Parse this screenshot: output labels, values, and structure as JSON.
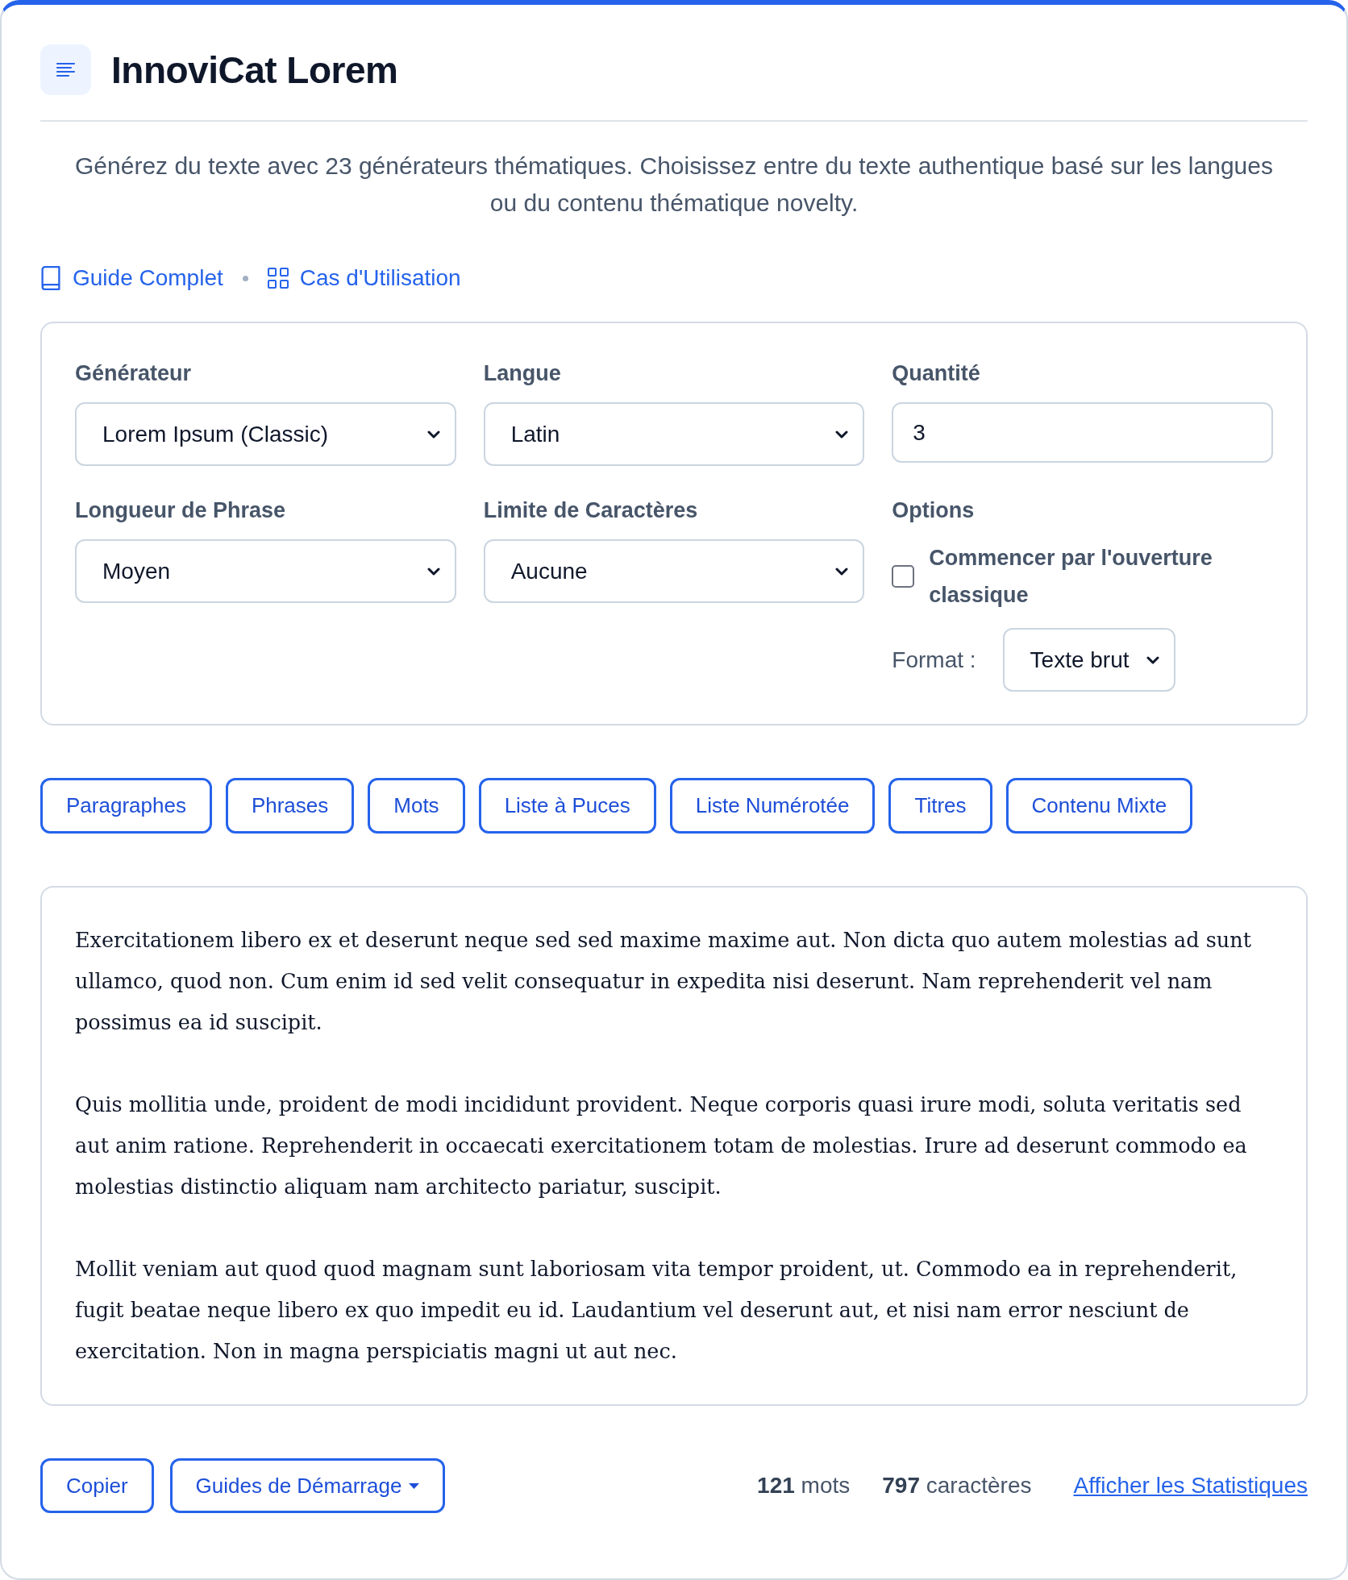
{
  "header": {
    "title": "InnoviCat Lorem"
  },
  "description": "Générez du texte avec 23 générateurs thématiques. Choisissez entre du texte authentique basé sur les langues ou du contenu thématique novelty.",
  "links": [
    {
      "kind": "book",
      "label": "Guide Complet"
    },
    {
      "kind": "grid",
      "label": "Cas d'Utilisation"
    }
  ],
  "settings": {
    "fields": [
      {
        "kind": "select",
        "label": "Générateur",
        "value": "Lorem Ipsum (Classic)"
      },
      {
        "kind": "select",
        "label": "Langue",
        "value": "Latin"
      },
      {
        "kind": "input",
        "label": "Quantité",
        "value": "3"
      },
      {
        "kind": "select",
        "label": "Longueur de Phrase",
        "value": "Moyen"
      },
      {
        "kind": "select",
        "label": "Limite de Caractères",
        "value": "Aucune"
      },
      {
        "kind": "options",
        "label": "Options",
        "checkbox": {
          "label": "Commencer par l'ouverture classique",
          "checked": false
        },
        "format": {
          "label": "Format :",
          "value": "Texte brut"
        }
      }
    ]
  },
  "generate_buttons": [
    "Paragraphes",
    "Phrases",
    "Mots",
    "Liste à Puces",
    "Liste Numérotée",
    "Titres",
    "Contenu Mixte"
  ],
  "output": {
    "paragraphs": [
      "Exercitationem libero ex et deserunt neque sed sed maxime maxime aut. Non dicta quo autem molestias ad sunt ullamco, quod non. Cum enim id sed velit consequatur in expedita nisi deserunt. Nam reprehenderit vel nam possimus ea id suscipit.",
      "Quis mollitia unde, proident de modi incididunt provident. Neque corporis quasi irure modi, soluta veritatis sed aut anim ratione. Reprehenderit in occaecati exercitationem totam de molestias. Irure ad deserunt commodo ea molestias distinctio aliquam nam architecto pariatur, suscipit.",
      "Mollit veniam aut quod quod magnam sunt laboriosam vita tempor proident, ut. Commodo ea in reprehenderit, fugit beatae neque libero ex quo impedit eu id. Laudantium vel deserunt aut, et nisi nam error nesciunt de exercitation. Non in magna perspiciatis magni ut aut nec."
    ]
  },
  "footer": {
    "actions": [
      {
        "kind": "button",
        "label": "Copier"
      },
      {
        "kind": "dropdown",
        "label": "Guides de Démarrage"
      }
    ],
    "stats": [
      "**121** mots",
      "**797** caractères"
    ],
    "stats_link": "Afficher les Statistiques"
  }
}
